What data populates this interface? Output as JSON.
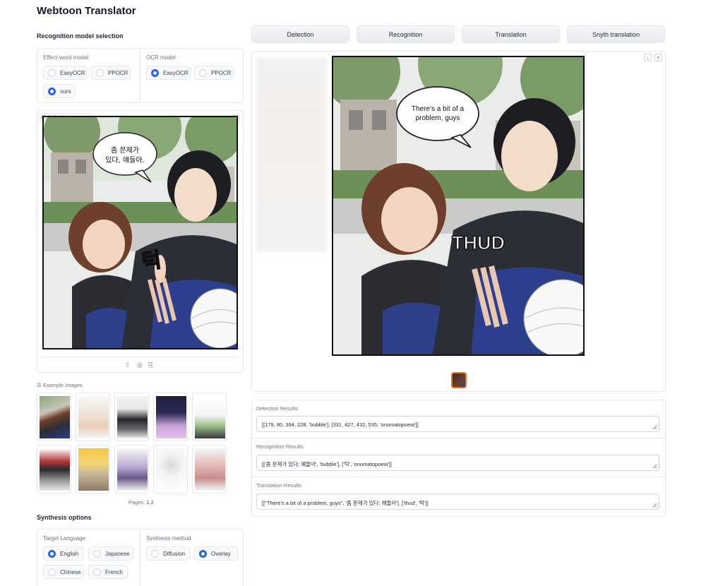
{
  "app": {
    "title": "Webtoon Translator"
  },
  "recognition": {
    "section_title": "Recognition model selection",
    "effect_word_label": "Effect-word model",
    "effect_word_options": [
      "EasyOCR",
      "PPOCR",
      "ours"
    ],
    "effect_word_selected": "ours",
    "ocr_label": "OCR model",
    "ocr_options": [
      "EasyOCR",
      "PPOCR"
    ],
    "ocr_selected": "EasyOCR"
  },
  "upload": {
    "label": "Upload your image"
  },
  "source_comic": {
    "bubble_line1": "좀 문제가",
    "bubble_line2": "있다, 얘들아.",
    "sfx": "턱"
  },
  "examples": {
    "label": "Example Images",
    "pages_label": "Pages:",
    "pages": [
      "1",
      "2"
    ]
  },
  "tabs": [
    "Detection",
    "Recognition",
    "Translation",
    "Snyth translation"
  ],
  "output_comic": {
    "bubble_line1": "There's a bit of a",
    "bubble_line2": "problem, guys",
    "sfx": "THUD"
  },
  "results": {
    "detection_label": "Detection Results",
    "detection_value": "[[179, 80, 394, 228, 'bubble'], [331, 427, 432, 535, 'onomatopoeia']]",
    "recognition_label": "Recognition Results",
    "recognition_value": "[['좀 문제가 있다; 얘들아', 'bubble'], ['턱', 'onomatopoeia']]",
    "translation_label": "Translation Results",
    "translation_value": "[[\"There's a bit of a problem, guys\", '좀 문제가 있다; 얘들아'], ['thud', '턱']]"
  },
  "synthesis": {
    "section_title": "Synthesis options",
    "language_label": "Target Language",
    "languages": [
      "English",
      "Japanese",
      "Chinese",
      "French"
    ],
    "language_selected": "English",
    "method_label": "Synthesis method",
    "methods": [
      "Diffusion",
      "Overlay"
    ],
    "method_selected": "Overlay"
  },
  "colors": {
    "accent": "#2563eb",
    "border": "#e5e7eb",
    "tab_bg": "#eceef1"
  }
}
